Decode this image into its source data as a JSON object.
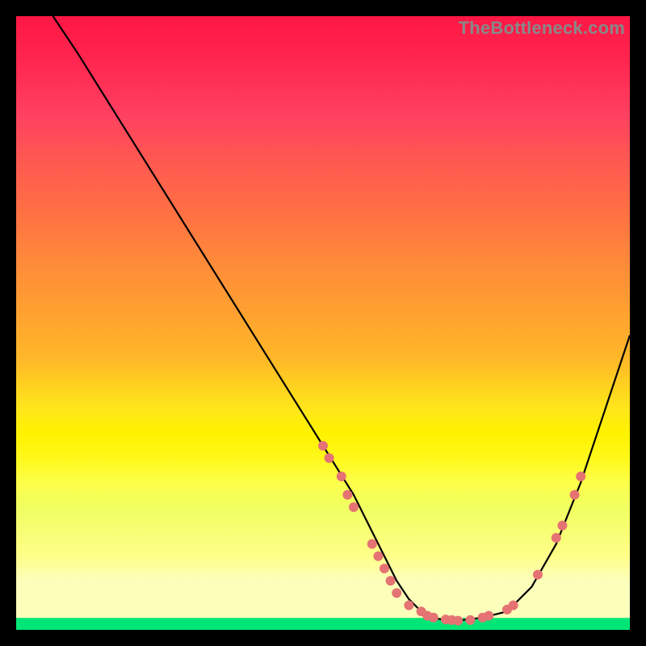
{
  "watermark": "TheBottleneck.com",
  "chart_data": {
    "type": "line",
    "title": "",
    "xlabel": "",
    "ylabel": "",
    "xlim": [
      0,
      100
    ],
    "ylim": [
      0,
      100
    ],
    "grid": false,
    "legend": false,
    "series": [
      {
        "name": "curve",
        "x": [
          6,
          10,
          20,
          30,
          40,
          50,
          55,
          60,
          62,
          64,
          66,
          68,
          70,
          72,
          76,
          80,
          84,
          88,
          92,
          96,
          100
        ],
        "y": [
          100,
          94,
          78,
          62,
          46,
          30,
          22,
          12,
          8,
          5,
          3,
          2,
          1.5,
          1.5,
          2,
          3,
          7,
          14,
          24,
          36,
          48
        ]
      }
    ],
    "markers": [
      {
        "x": 50,
        "y": 30
      },
      {
        "x": 51,
        "y": 28
      },
      {
        "x": 53,
        "y": 25
      },
      {
        "x": 54,
        "y": 22
      },
      {
        "x": 55,
        "y": 20
      },
      {
        "x": 58,
        "y": 14
      },
      {
        "x": 59,
        "y": 12
      },
      {
        "x": 60,
        "y": 10
      },
      {
        "x": 61,
        "y": 8
      },
      {
        "x": 62,
        "y": 6
      },
      {
        "x": 64,
        "y": 4
      },
      {
        "x": 66,
        "y": 3
      },
      {
        "x": 67,
        "y": 2.3
      },
      {
        "x": 68,
        "y": 2
      },
      {
        "x": 70,
        "y": 1.7
      },
      {
        "x": 71,
        "y": 1.6
      },
      {
        "x": 72,
        "y": 1.5
      },
      {
        "x": 74,
        "y": 1.6
      },
      {
        "x": 76,
        "y": 2
      },
      {
        "x": 77,
        "y": 2.3
      },
      {
        "x": 80,
        "y": 3.3
      },
      {
        "x": 81,
        "y": 4
      },
      {
        "x": 85,
        "y": 9
      },
      {
        "x": 88,
        "y": 15
      },
      {
        "x": 89,
        "y": 17
      },
      {
        "x": 91,
        "y": 22
      },
      {
        "x": 92,
        "y": 25
      }
    ],
    "gradient_stops": [
      {
        "pos": 0,
        "color": "#ff1744"
      },
      {
        "pos": 50,
        "color": "#ffb300"
      },
      {
        "pos": 80,
        "color": "#ffee58"
      },
      {
        "pos": 98,
        "color": "#fbffba"
      },
      {
        "pos": 100,
        "color": "#00e676"
      }
    ]
  }
}
